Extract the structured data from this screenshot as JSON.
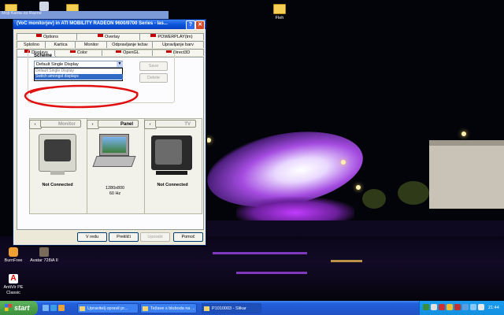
{
  "desktop": {
    "icons": [
      {
        "label": "Moji"
      },
      {
        "label": "Kanta za"
      },
      {
        "label": "Razne"
      },
      {
        "label": "Fleh"
      },
      {
        "label": "BurnFree"
      },
      {
        "label": "Avatar 728iA II"
      },
      {
        "label": "AntiVir PE Classic"
      }
    ]
  },
  "bg_window": {
    "title": "Moji  Kanta za  Razne"
  },
  "dialog": {
    "title": "(VoC monitorjev) in ATI MOBILITY RADEON 9600/9700 Series - las...",
    "help": "?",
    "close": "✕",
    "tabs_row1": [
      "Options",
      "Overlay",
      "POWERPLAY(tm)"
    ],
    "tabs_row2": [
      "Splošno",
      "Kartica",
      "Monitor",
      "Odpravljanje težav",
      "Upravljanje barv"
    ],
    "tabs_row3": [
      "Displays",
      "Color",
      "OpenGL",
      "Direct3D"
    ],
    "scheme": {
      "label": "Scheme",
      "selected": "Default Single Display",
      "options": [
        "Default Single Display",
        "Switch amongst displays"
      ],
      "save": "Save",
      "delete": "Delete"
    },
    "devices": [
      {
        "button": "Monitor",
        "status": "Not Connected",
        "info": ""
      },
      {
        "button": "Panel",
        "status": "",
        "info": "1280x800\n60 Hz"
      },
      {
        "button": "TV",
        "status": "Not Connected",
        "info": ""
      }
    ],
    "buttons": {
      "ok": "V redu",
      "cancel": "Prekliči",
      "apply": "Uporabi",
      "help": "Pomoč"
    }
  },
  "taskbar": {
    "start": "start",
    "tasks": [
      {
        "label": "Upravitelj opravil pr..."
      },
      {
        "label": "Težave s bluboda na ..."
      },
      {
        "label": "P1010003 - Slikar"
      }
    ],
    "clock": "21:44"
  }
}
